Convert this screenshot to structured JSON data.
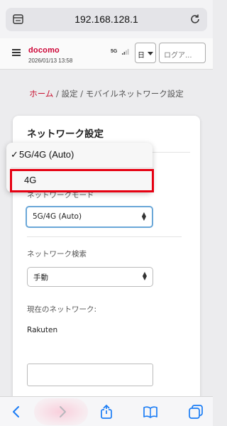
{
  "browser": {
    "url": "192.168.128.1",
    "icons": {
      "tabs": "tabs-icon",
      "reload": "reload-icon"
    }
  },
  "header": {
    "brand": "docomo",
    "datetime": "2026/01/13 13:58",
    "network_type": "5G",
    "language": "日",
    "login_placeholder": "ログア..."
  },
  "breadcrumb": {
    "home": "ホーム",
    "rest": " / 設定 / モバイルネットワーク設定"
  },
  "card": {
    "title": "ネットワーク設定",
    "mode_label": "ネットワークモード",
    "mode_value": "5G/4G (Auto)",
    "search_label": "ネットワーク検索",
    "search_value": "手動",
    "current_label": "現在のネットワーク:",
    "current_value": "Rakuten"
  },
  "dropdown": {
    "options": [
      {
        "label": "5G/4G (Auto)",
        "checked": true
      },
      {
        "label": "4G",
        "checked": false
      }
    ],
    "checkmark": "✓",
    "highlight_color": "#e60012"
  },
  "toolbar": {
    "icons": [
      "back-icon",
      "forward-icon",
      "share-icon",
      "bookmarks-icon",
      "tabs-overview-icon"
    ]
  },
  "colors": {
    "brand": "#cc0033",
    "breadcrumb_home": "#c8102e",
    "toolbar_accent": "#1a7cf5"
  }
}
